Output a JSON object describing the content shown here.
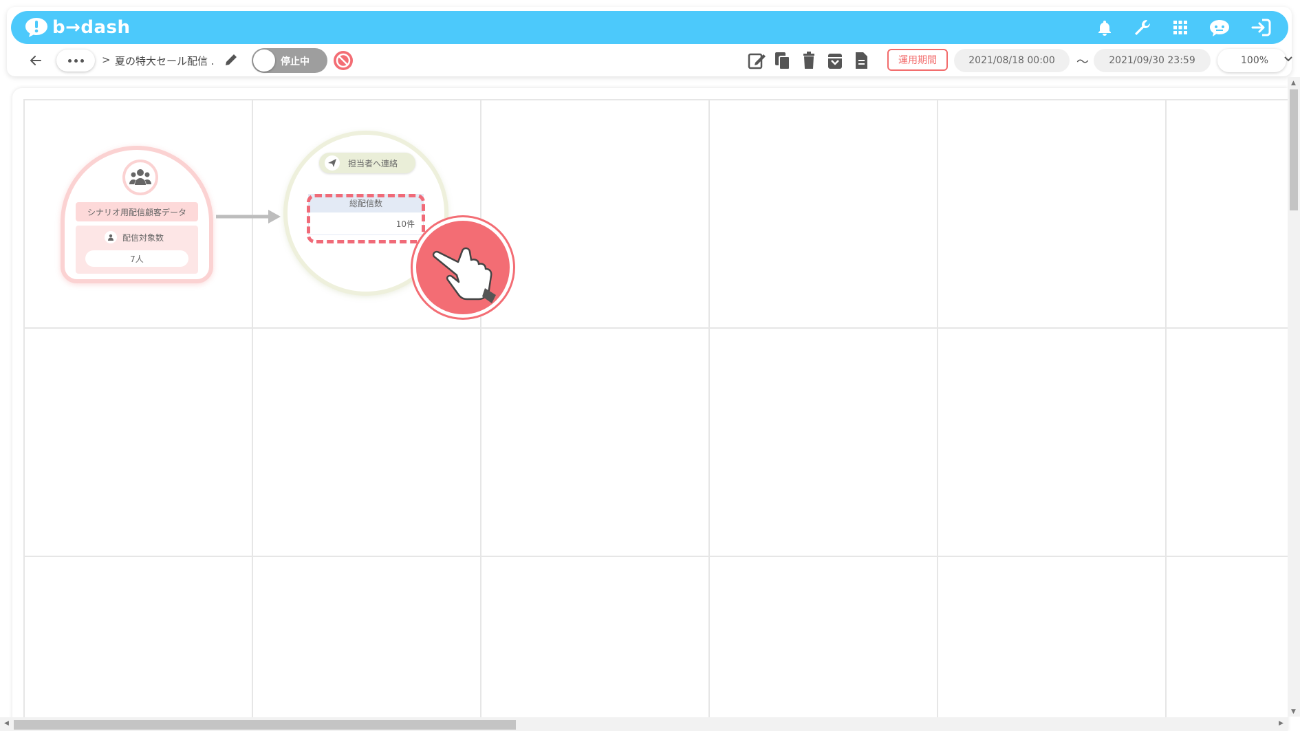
{
  "app": {
    "logo_text": "b→dash"
  },
  "breadcrumb": {
    "separator": ">",
    "title": "夏の特大セール配信 ."
  },
  "status_toggle": {
    "label": "停止中"
  },
  "toolbar": {
    "period_button_label": "運用期間",
    "date_start": "2021/08/18 00:00",
    "date_separator": "〜",
    "date_end": "2021/09/30 23:59",
    "zoom": "100%"
  },
  "canvas": {
    "source_node": {
      "title": "シナリオ用配信顧客データ",
      "count_label": "配信対象数",
      "count_value": "7人"
    },
    "action_node": {
      "head_label": "担当者へ連絡",
      "stat_title": "総配信数",
      "stat_value": "10件"
    }
  },
  "colors": {
    "header": "#4cc9fb",
    "accent": "#f36d74",
    "source_node": "#fbd2d2",
    "action_node": "#eef0dc"
  }
}
